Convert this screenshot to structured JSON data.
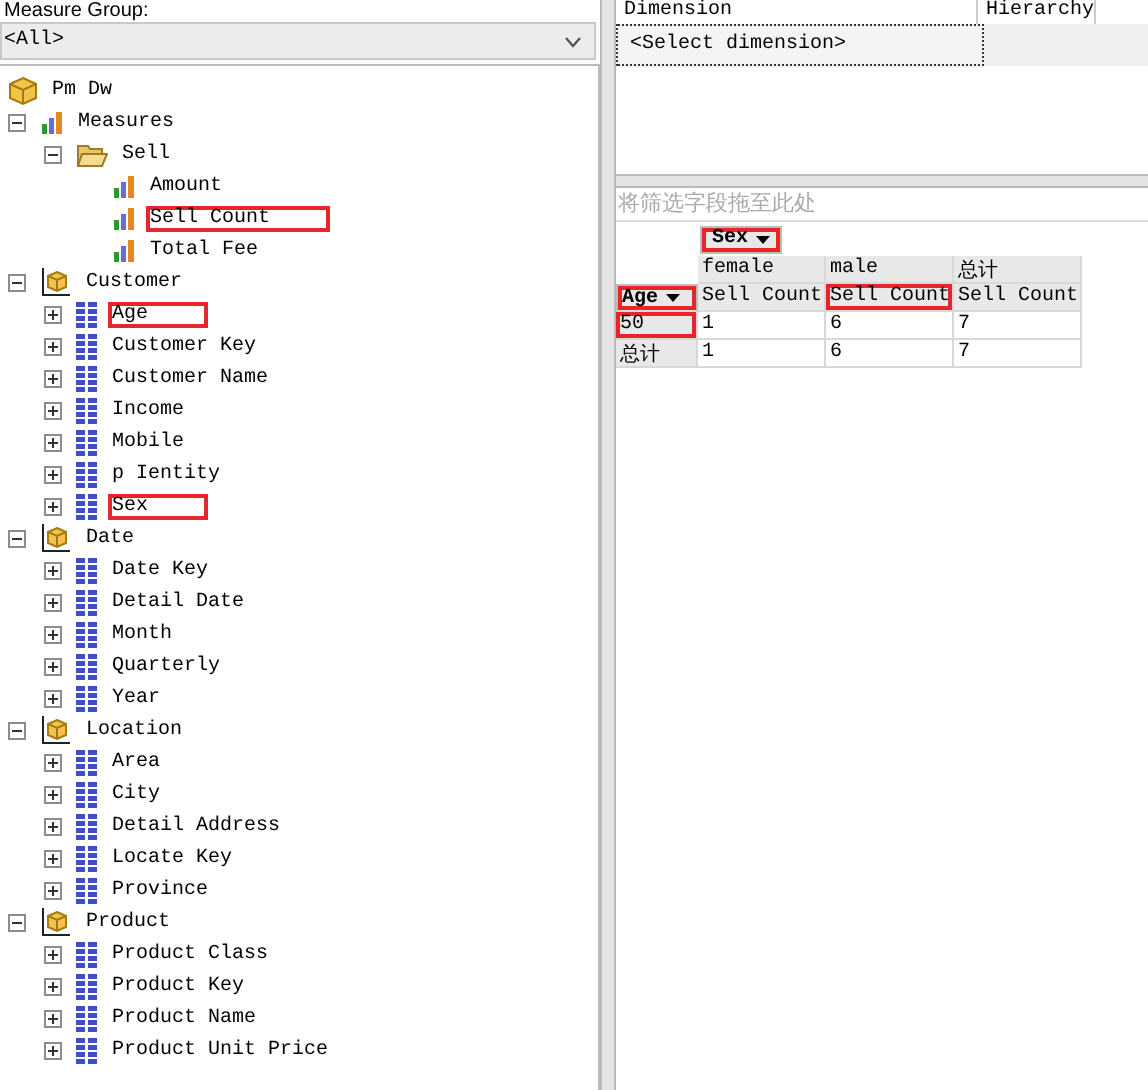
{
  "measure_group": {
    "label": "Measure Group:",
    "value": "<All>"
  },
  "tree": [
    {
      "kind": "cube",
      "label": "Pm Dw",
      "highlighted": false,
      "children": [
        {
          "kind": "measures",
          "label": "Measures",
          "expanded": true,
          "highlighted": false,
          "children": [
            {
              "kind": "folder",
              "label": "Sell",
              "expanded": true,
              "highlighted": false,
              "children": [
                {
                  "kind": "measure",
                  "label": "Amount",
                  "highlighted": false
                },
                {
                  "kind": "measure",
                  "label": "Sell Count",
                  "highlighted": true
                },
                {
                  "kind": "measure",
                  "label": "Total Fee",
                  "highlighted": false
                }
              ]
            }
          ]
        },
        {
          "kind": "dimension",
          "label": "Customer",
          "expanded": true,
          "highlighted": false,
          "children": [
            {
              "kind": "attribute",
              "label": "Age",
              "expanded": false,
              "highlighted": true
            },
            {
              "kind": "attribute",
              "label": "Customer Key",
              "expanded": false,
              "highlighted": false
            },
            {
              "kind": "attribute",
              "label": "Customer Name",
              "expanded": false,
              "highlighted": false
            },
            {
              "kind": "attribute",
              "label": "Income",
              "expanded": false,
              "highlighted": false
            },
            {
              "kind": "attribute",
              "label": "Mobile",
              "expanded": false,
              "highlighted": false
            },
            {
              "kind": "attribute",
              "label": "p Ientity",
              "expanded": false,
              "highlighted": false
            },
            {
              "kind": "attribute",
              "label": "Sex",
              "expanded": false,
              "highlighted": true
            }
          ]
        },
        {
          "kind": "dimension",
          "label": "Date",
          "expanded": true,
          "highlighted": false,
          "children": [
            {
              "kind": "attribute",
              "label": "Date Key",
              "expanded": false,
              "highlighted": false
            },
            {
              "kind": "attribute",
              "label": "Detail Date",
              "expanded": false,
              "highlighted": false
            },
            {
              "kind": "attribute",
              "label": "Month",
              "expanded": false,
              "highlighted": false
            },
            {
              "kind": "attribute",
              "label": "Quarterly",
              "expanded": false,
              "highlighted": false
            },
            {
              "kind": "attribute",
              "label": "Year",
              "expanded": false,
              "highlighted": false
            }
          ]
        },
        {
          "kind": "dimension",
          "label": "Location",
          "expanded": true,
          "highlighted": false,
          "children": [
            {
              "kind": "attribute",
              "label": "Area",
              "expanded": false,
              "highlighted": false
            },
            {
              "kind": "attribute",
              "label": "City",
              "expanded": false,
              "highlighted": false
            },
            {
              "kind": "attribute",
              "label": "Detail Address",
              "expanded": false,
              "highlighted": false
            },
            {
              "kind": "attribute",
              "label": "Locate Key",
              "expanded": false,
              "highlighted": false
            },
            {
              "kind": "attribute",
              "label": "Province",
              "expanded": false,
              "highlighted": false
            }
          ]
        },
        {
          "kind": "dimension",
          "label": "Product",
          "expanded": true,
          "highlighted": false,
          "children": [
            {
              "kind": "attribute",
              "label": "Product Class",
              "expanded": false,
              "highlighted": false
            },
            {
              "kind": "attribute",
              "label": "Product Key",
              "expanded": false,
              "highlighted": false
            },
            {
              "kind": "attribute",
              "label": "Product Name",
              "expanded": false,
              "highlighted": false
            },
            {
              "kind": "attribute",
              "label": "Product Unit Price",
              "expanded": false,
              "highlighted": false
            }
          ]
        }
      ]
    }
  ],
  "filter_grid": {
    "columns": [
      "Dimension",
      "Hierarchy"
    ],
    "row": "<Select dimension>"
  },
  "pivot": {
    "filter_placeholder": "将筛选字段拖至此处",
    "column_field": {
      "label": "Sex",
      "highlighted": true
    },
    "row_field": {
      "label": "Age",
      "highlighted": true
    },
    "columns": [
      {
        "label": "female",
        "measure": "Sell Count",
        "highlighted": false
      },
      {
        "label": "male",
        "measure": "Sell Count",
        "highlighted": true
      },
      {
        "label": "总计",
        "measure": "Sell Count",
        "highlighted": false
      }
    ],
    "rows": [
      {
        "label": "50",
        "highlighted": true,
        "values": [
          "1",
          "6",
          "7"
        ]
      },
      {
        "label": "总计",
        "highlighted": false,
        "values": [
          "1",
          "6",
          "7"
        ]
      }
    ]
  }
}
